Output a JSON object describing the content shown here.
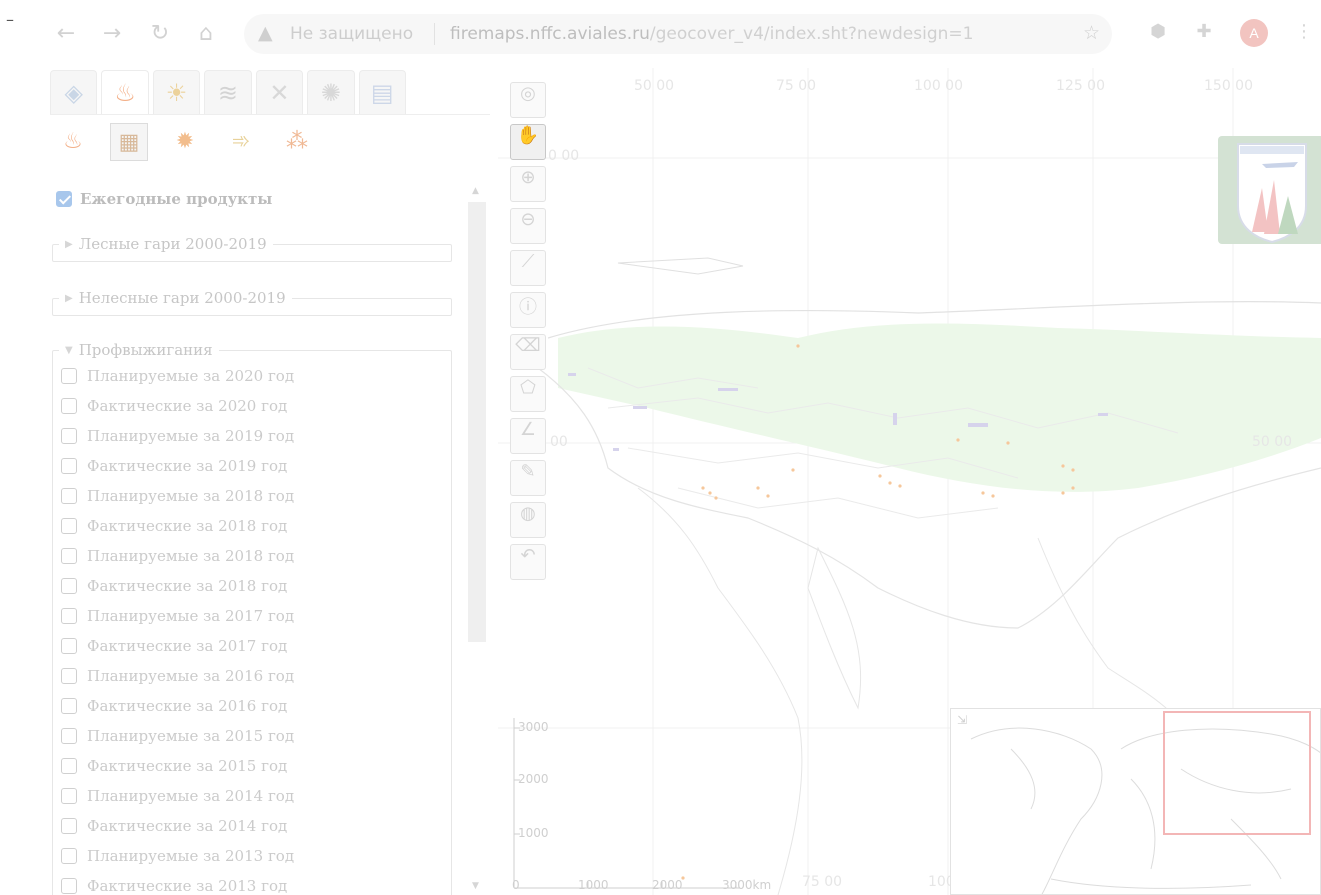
{
  "browser": {
    "insecure_label": "Не защищено",
    "url_host": "firemaps.nffc.aviales.ru",
    "url_path": "/geocover_v4/index.sht?newdesign=1",
    "avatar_letter": "A",
    "icons": {
      "back": "arrow-left-icon",
      "forward": "arrow-right-icon",
      "reload": "reload-icon",
      "home": "home-icon",
      "warning": "warning-icon",
      "star": "star-icon",
      "shield": "shield-extension-icon",
      "puzzle": "puzzle-icon",
      "menu": "kebab-menu-icon"
    }
  },
  "panel": {
    "tabs": [
      {
        "icon": "satellite-icon",
        "active": false
      },
      {
        "icon": "fire-icon",
        "active": true
      },
      {
        "icon": "weather-icon",
        "active": false
      },
      {
        "icon": "layers-icon",
        "active": false
      },
      {
        "icon": "tools-icon",
        "active": false
      },
      {
        "icon": "settings-icon",
        "active": false
      },
      {
        "icon": "table-icon",
        "active": false
      }
    ],
    "subtools": [
      {
        "icon": "flame-icon",
        "active": false
      },
      {
        "icon": "fire-archive-icon",
        "active": true
      },
      {
        "icon": "burn-icon",
        "active": false
      },
      {
        "icon": "fire-layers-icon",
        "active": false
      },
      {
        "icon": "fire-points-icon",
        "active": false
      }
    ],
    "annual_products": {
      "label": "Ежегодные продукты",
      "checked": true
    },
    "forest_burns": {
      "label": "Лесные гари 2000-2019"
    },
    "nonforest_burns": {
      "label": "Нелесные гари 2000-2019"
    },
    "controlled_burns": {
      "label": "Профвыжигания",
      "items": [
        "Планируемые за 2020 год",
        "Фактические за 2020 год",
        "Планируемые за 2019 год",
        "Фактические за 2019 год",
        "Планируемые за 2018 год",
        "Фактические за 2018 год",
        "Планируемые за 2018 год",
        "Фактические за 2018 год",
        "Планируемые за 2017 год",
        "Фактические за 2017 год",
        "Планируемые за 2016 год",
        "Фактические за 2016 год",
        "Планируемые за 2015 год",
        "Фактические за 2015 год",
        "Планируемые за 2014 год",
        "Фактические за 2014 год",
        "Планируемые за 2013 год",
        "Фактические за 2013 год"
      ]
    }
  },
  "map": {
    "top_coords": [
      "50 00",
      "75 00",
      "100 00",
      "125 00",
      "150 00"
    ],
    "left_coords": [
      "0 00",
      "00"
    ],
    "right_coord": "50 00",
    "bottom_coords": [
      "75 00",
      "100"
    ],
    "tools": [
      {
        "icon": "zoom-extent-icon",
        "active": false
      },
      {
        "icon": "pan-hand-icon",
        "active": true
      },
      {
        "icon": "zoom-in-icon",
        "active": false
      },
      {
        "icon": "zoom-out-icon",
        "active": false
      },
      {
        "icon": "ruler-icon",
        "active": false
      },
      {
        "icon": "info-icon",
        "active": false
      },
      {
        "icon": "eraser-icon",
        "active": false
      },
      {
        "icon": "polygon-select-icon",
        "active": false
      },
      {
        "icon": "angle-measure-icon",
        "active": false
      },
      {
        "icon": "pin-marker-icon",
        "active": false
      },
      {
        "icon": "globe-icon",
        "active": false
      },
      {
        "icon": "undo-icon",
        "active": false
      }
    ],
    "scale_y_labels": [
      "3000",
      "2000",
      "1000"
    ],
    "scale_x_labels": [
      "0",
      "1000",
      "2000",
      "3000km"
    ]
  },
  "colors": {
    "forest_overlay": "#e7f6e4",
    "fire_points": "#f6c79b",
    "overview_frame": "#f3b6b6",
    "logo_bg": "#d3e2d3"
  }
}
